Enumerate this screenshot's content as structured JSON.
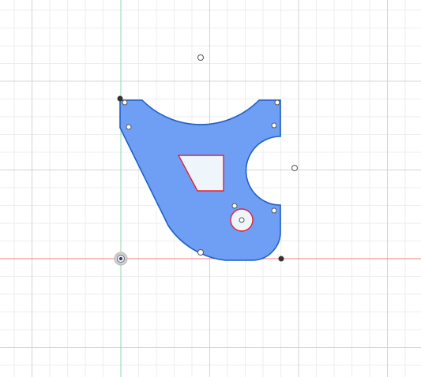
{
  "viewport": {
    "background": "#ffffff",
    "grid": {
      "visible": true,
      "minor_color": "#eeeeee",
      "major_color": "#d4d4d4"
    },
    "axes": {
      "x_axis_color": "#f08080",
      "y_axis_color": "#8fd9a8"
    }
  },
  "sketch": {
    "profile_fill": "#6f9ff5",
    "profile_stroke": "#1f5fc4",
    "hole_fill": "#eef6fb",
    "hole_stroke": "#e0223a",
    "point_fill": "#ffffff",
    "point_stroke": "#555555",
    "fixed_point_color": "#333333"
  }
}
